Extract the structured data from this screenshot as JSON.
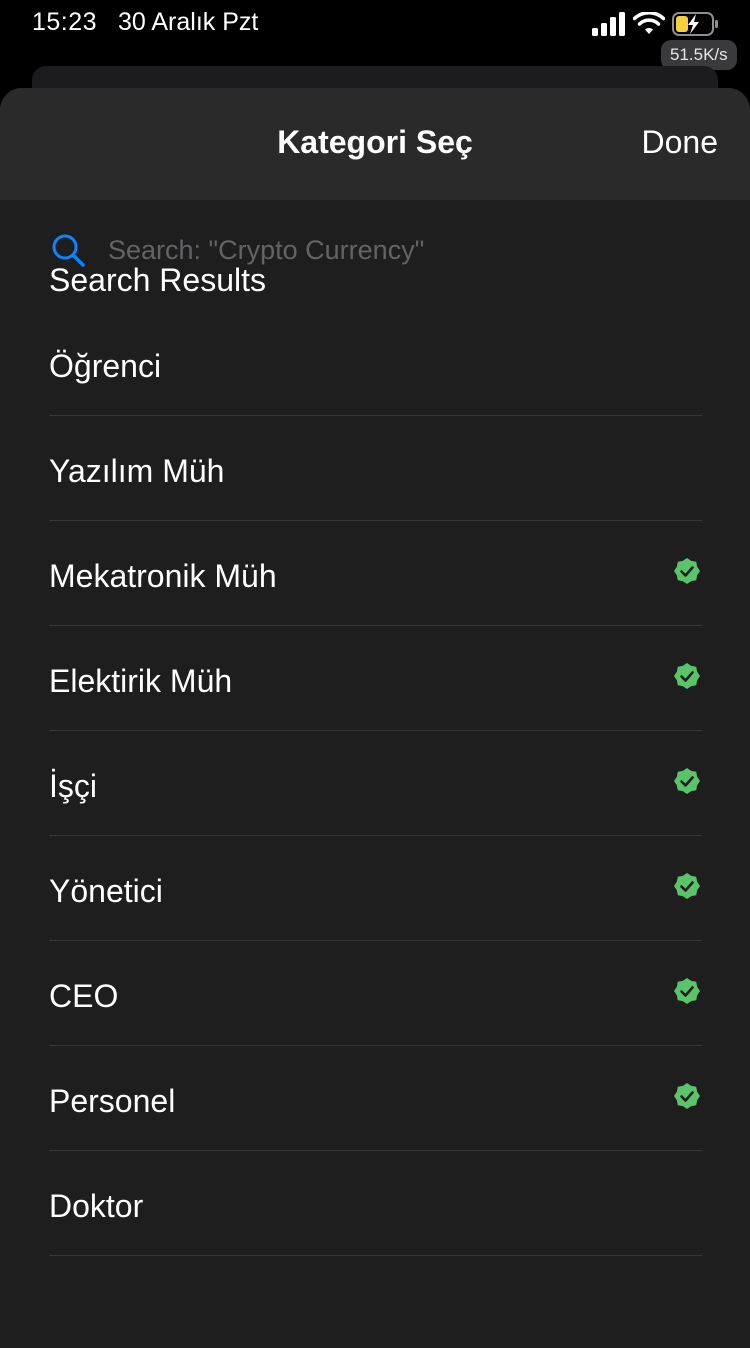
{
  "status_bar": {
    "time": "15:23",
    "date": "30 Aralık Pzt",
    "net_speed": "51.5K/s",
    "icons": [
      "signal-icon",
      "wifi-icon",
      "battery-charging-icon"
    ]
  },
  "header": {
    "title": "Kategori Seç",
    "done_label": "Done"
  },
  "search": {
    "placeholder": "Search: \"Crypto Currency\"",
    "value": "",
    "icon": "search-icon"
  },
  "results": {
    "section_title": "Search Results",
    "items": [
      {
        "label": "Öğrenci",
        "verified": false
      },
      {
        "label": "Yazılım Müh",
        "verified": false
      },
      {
        "label": "Mekatronik Müh",
        "verified": true
      },
      {
        "label": "Elektirik Müh",
        "verified": true
      },
      {
        "label": "İşçi",
        "verified": true
      },
      {
        "label": "Yönetici",
        "verified": true
      },
      {
        "label": "CEO",
        "verified": true
      },
      {
        "label": "Personel",
        "verified": true
      },
      {
        "label": "Doktor",
        "verified": false
      }
    ]
  },
  "colors": {
    "accent_blue": "#0a84ff",
    "verified_green": "#5ac46b",
    "sheet_background": "#1e1e1f",
    "header_background": "#2a2a2b",
    "separator": "#38383a"
  }
}
